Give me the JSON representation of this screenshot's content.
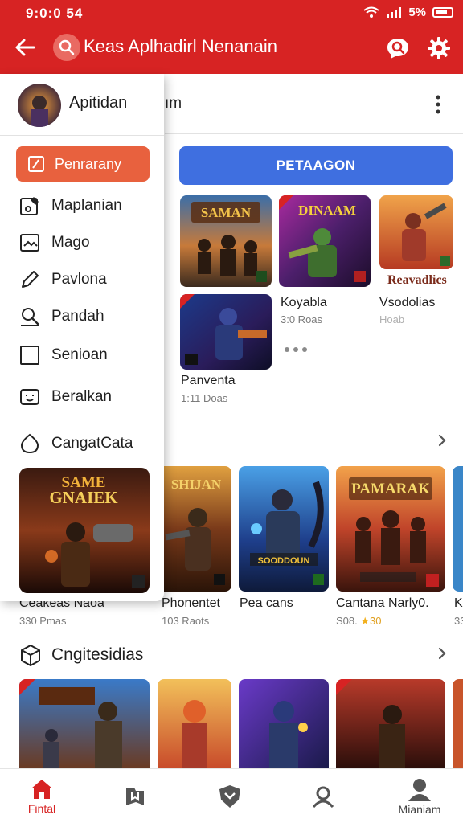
{
  "status_bar": {
    "time": "9:0:0 54",
    "battery": "5%"
  },
  "app_bar": {
    "title": "Keas Aplhadirl Nenanain"
  },
  "header": {
    "title_fragment": "ım"
  },
  "main": {
    "primary_button": "PETAAGON",
    "grid": [
      {
        "title": "",
        "sub": "",
        "art_label": "SAMAN"
      },
      {
        "title": "",
        "sub": "",
        "art_label": "DINAAM"
      },
      {
        "title": "Reavadlics",
        "sub": "",
        "art_label": ""
      },
      {
        "title": "Panventa",
        "sub": "1:11 Doas",
        "art_label": ""
      },
      {
        "title": "Koyabla",
        "sub": "3:0 Roas",
        "art_label": ""
      },
      {
        "title": "Vsodolias",
        "sub": "Hoab",
        "art_label": ""
      }
    ],
    "row2": [
      {
        "title": "Ceakeas Naoa",
        "sub": "330 Pmas",
        "art_label": ""
      },
      {
        "title": "Phonentet",
        "sub": "103 Raots",
        "art_label": "SHIJAN"
      },
      {
        "title": "Pea cans",
        "sub": "",
        "art_label": "SOODDOUN"
      },
      {
        "title": "Cantana Narly0.",
        "sub": "S08.",
        "rating": "30",
        "art_label": "PAMARAK"
      },
      {
        "title": "K",
        "sub": "33",
        "art_label": ""
      }
    ],
    "section2": {
      "title": "Cngitesidias"
    }
  },
  "drawer": {
    "user_name": "Apitidan",
    "active_item": "Penrarany",
    "items": [
      {
        "label": "Maplanian",
        "icon": "note-icon"
      },
      {
        "label": "Mago",
        "icon": "image-icon"
      },
      {
        "label": "Pavlona",
        "icon": "pen-icon"
      },
      {
        "label": "Pandah",
        "icon": "search-icon"
      },
      {
        "label": "Senioan",
        "icon": "square-icon"
      },
      {
        "label": "Beralkan",
        "icon": "face-icon"
      },
      {
        "label": "CangatCata",
        "icon": "drop-icon"
      }
    ],
    "banner": {
      "line1": "SAME",
      "line2": "GNAIEK"
    }
  },
  "bottom_nav": [
    {
      "label": "Fintal",
      "icon": "home-icon",
      "active": true
    },
    {
      "label": "",
      "icon": "bookmark-icon",
      "active": false
    },
    {
      "label": "",
      "icon": "shield-icon",
      "active": false
    },
    {
      "label": "",
      "icon": "person-icon",
      "active": false
    },
    {
      "label": "Mianiam",
      "icon": "account-icon",
      "active": false
    }
  ],
  "colors": {
    "brand_red": "#d72323",
    "accent_orange": "#e8613e",
    "primary_blue": "#3f6fe0"
  }
}
